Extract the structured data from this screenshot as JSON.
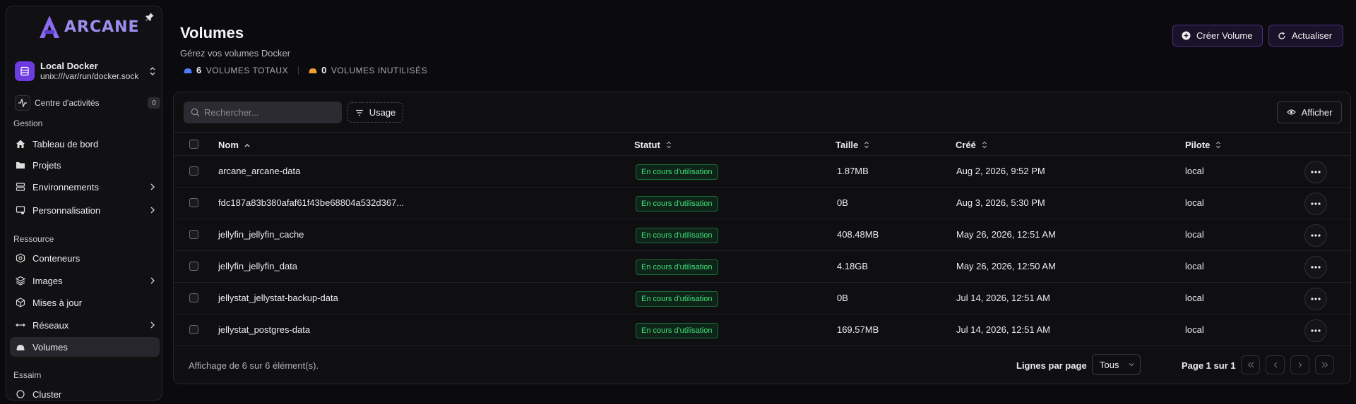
{
  "sidebar": {
    "logo_text": "ARCANE",
    "environment": {
      "name": "Local Docker",
      "socket": "unix:///var/run/docker.sock"
    },
    "activity": {
      "label": "Centre d'activités",
      "count": "0"
    },
    "sections": {
      "gestion": "Gestion",
      "ressource": "Ressource",
      "essaim": "Essaim"
    },
    "gestion_items": [
      {
        "label": "Tableau de bord",
        "icon": "home-icon"
      },
      {
        "label": "Projets",
        "icon": "folder-icon"
      },
      {
        "label": "Environnements",
        "icon": "server-icon"
      },
      {
        "label": "Personnalisation",
        "icon": "customize-icon"
      }
    ],
    "ressource_items": [
      {
        "label": "Conteneurs",
        "icon": "container-icon"
      },
      {
        "label": "Images",
        "icon": "layers-icon"
      },
      {
        "label": "Mises à jour",
        "icon": "package-icon"
      },
      {
        "label": "Réseaux",
        "icon": "network-icon"
      },
      {
        "label": "Volumes",
        "icon": "volume-icon"
      }
    ],
    "essaim_items": [
      {
        "label": "Cluster",
        "icon": "cluster-icon"
      }
    ]
  },
  "header": {
    "title": "Volumes",
    "subtitle": "Gérez vos volumes Docker",
    "stats": [
      {
        "value": "6",
        "label": "VOLUMES TOTAUX",
        "color": "#4f7cff"
      },
      {
        "value": "0",
        "label": "VOLUMES INUTILISÉS",
        "color": "#f0a030"
      }
    ],
    "create_label": "Créer Volume",
    "refresh_label": "Actualiser"
  },
  "toolbar": {
    "search_placeholder": "Rechercher...",
    "usage_label": "Usage",
    "view_label": "Afficher"
  },
  "table": {
    "columns": {
      "name": "Nom",
      "status": "Statut",
      "size": "Taille",
      "created": "Créé",
      "driver": "Pilote"
    },
    "rows": [
      {
        "name": "arcane_arcane-data",
        "status": "En cours d'utilisation",
        "size": "1.87MB",
        "created": "Aug 2, 2026, 9:52 PM",
        "driver": "local"
      },
      {
        "name": "fdc187a83b380afaf61f43be68804a532d367...",
        "status": "En cours d'utilisation",
        "size": "0B",
        "created": "Aug 3, 2026, 5:30 PM",
        "driver": "local"
      },
      {
        "name": "jellyfin_jellyfin_cache",
        "status": "En cours d'utilisation",
        "size": "408.48MB",
        "created": "May 26, 2026, 12:51 AM",
        "driver": "local"
      },
      {
        "name": "jellyfin_jellyfin_data",
        "status": "En cours d'utilisation",
        "size": "4.18GB",
        "created": "May 26, 2026, 12:50 AM",
        "driver": "local"
      },
      {
        "name": "jellystat_jellystat-backup-data",
        "status": "En cours d'utilisation",
        "size": "0B",
        "created": "Jul 14, 2026, 12:51 AM",
        "driver": "local"
      },
      {
        "name": "jellystat_postgres-data",
        "status": "En cours d'utilisation",
        "size": "169.57MB",
        "created": "Jul 14, 2026, 12:51 AM",
        "driver": "local"
      }
    ]
  },
  "footer": {
    "info": "Affichage de 6 sur 6 élément(s).",
    "rows_per_page_label": "Lignes par page",
    "rows_per_page_value": "Tous",
    "page_info": "Page 1 sur 1"
  }
}
